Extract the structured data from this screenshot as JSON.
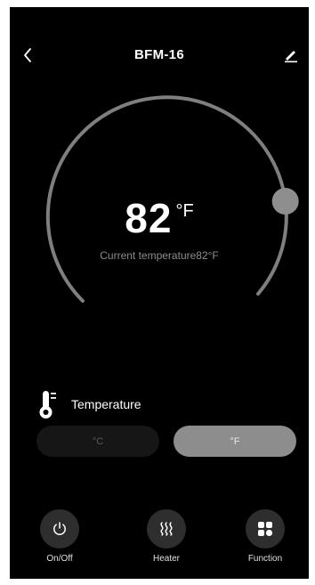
{
  "header": {
    "title": "BFM-16",
    "back_icon": "chevron-left-icon",
    "edit_icon": "pencil-icon"
  },
  "dial": {
    "set_temperature": "82",
    "unit": "°F",
    "current_temperature_label": "Current temperature82°F",
    "level_fraction": 0.82
  },
  "temperature_section": {
    "icon": "thermometer-icon",
    "label": "Temperature"
  },
  "unit_toggle": {
    "celsius_label": "°C",
    "fahrenheit_label": "°F",
    "selected": "°F"
  },
  "bottom_bar": {
    "on_off_label": "On/Off",
    "heater_label": "Heater",
    "function_label": "Function"
  },
  "colors": {
    "background": "#000000",
    "dial_arc": "#7f7f7f",
    "knob": "#8e8e8e",
    "selected_unit": "#8d8d8d",
    "button_circle": "#2e2e2e"
  }
}
